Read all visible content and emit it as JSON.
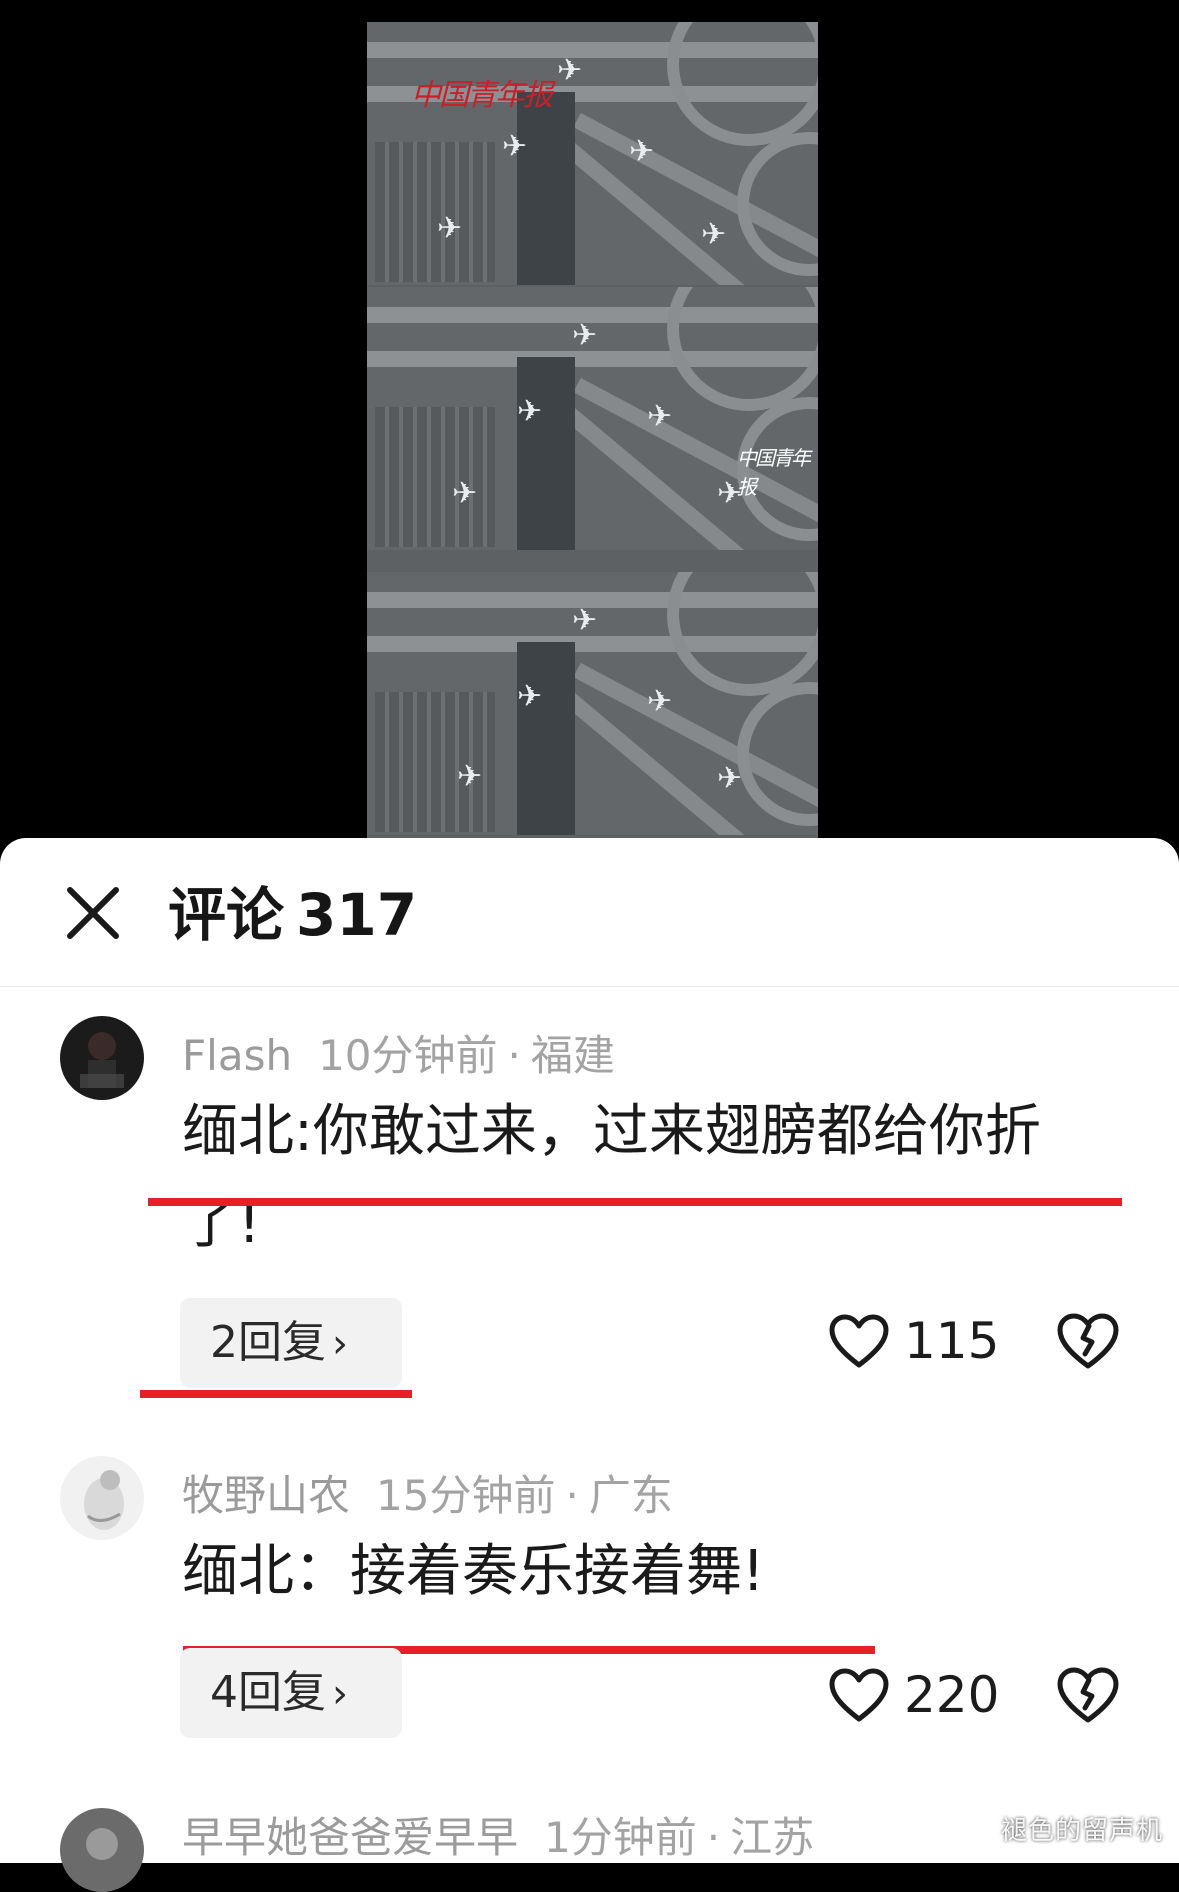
{
  "video": {
    "watermark_top": "中国青年报",
    "watermark_mid": "中国青年报"
  },
  "sheet": {
    "title_label": "评论",
    "comment_count": "317"
  },
  "comments": [
    {
      "username": "Flash",
      "time": "10分钟前",
      "location": "福建",
      "text": "缅北:你敢过来，过来翅膀都给你折了!",
      "reply_label": "2回复",
      "likes": "115"
    },
    {
      "username": "牧野山农",
      "time": "15分钟前",
      "location": "广东",
      "text": "缅北：接着奏乐接着舞!",
      "reply_label": "4回复",
      "likes": "220"
    },
    {
      "username": "早早她爸爸爱早早",
      "time": "1分钟前",
      "location": "江苏"
    }
  ],
  "meta_separator": "·",
  "chevron": "›",
  "corner_watermark": "褪色的留声机",
  "colors": {
    "underline": "#e4212b",
    "meta": "#a3a3a3"
  }
}
